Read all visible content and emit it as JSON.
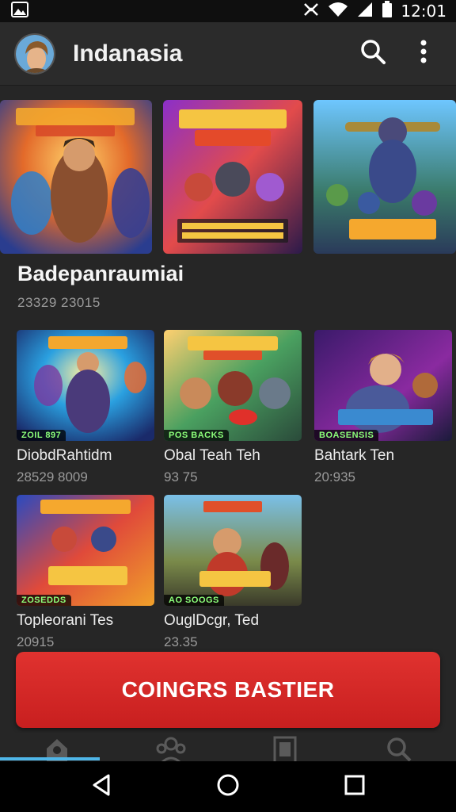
{
  "status_bar": {
    "time": "12:01",
    "icons": [
      "gallery-icon",
      "nfc-icon",
      "wifi-icon",
      "signal-icon",
      "battery-icon"
    ]
  },
  "app_bar": {
    "title": "Indanasia",
    "icons": [
      "avatar",
      "search-icon",
      "more-vert-icon"
    ]
  },
  "section": {
    "title": "Badepanraumiai",
    "subtitle": "23329  23015"
  },
  "grid": [
    {
      "title": "DiobdRahtidm",
      "meta": "28529  8009",
      "tag": "ZOIL 897"
    },
    {
      "title": "Obal Teah Teh",
      "meta": "93 75",
      "tag": "POS BACKS"
    },
    {
      "title": "Bahtark Ten",
      "meta": "20:935",
      "tag": "BOASENSIS"
    },
    {
      "title": "Topleorani Tes",
      "meta": "20915",
      "tag": "ZOSEDDS"
    },
    {
      "title": "OuglDcgr, Ted",
      "meta": "23.35",
      "tag": "AO SOOGS"
    }
  ],
  "cta": {
    "label": "COINGRS BASTIER"
  },
  "bottom_nav": [
    "home-icon",
    "people-icon",
    "library-icon",
    "search-icon"
  ],
  "system_nav": [
    "back-icon",
    "home-circle-icon",
    "recents-icon"
  ],
  "colors": {
    "cta": "#d42a27",
    "background": "#262626",
    "appbar": "#2b2b2b",
    "accent": "#4fb6e8"
  }
}
